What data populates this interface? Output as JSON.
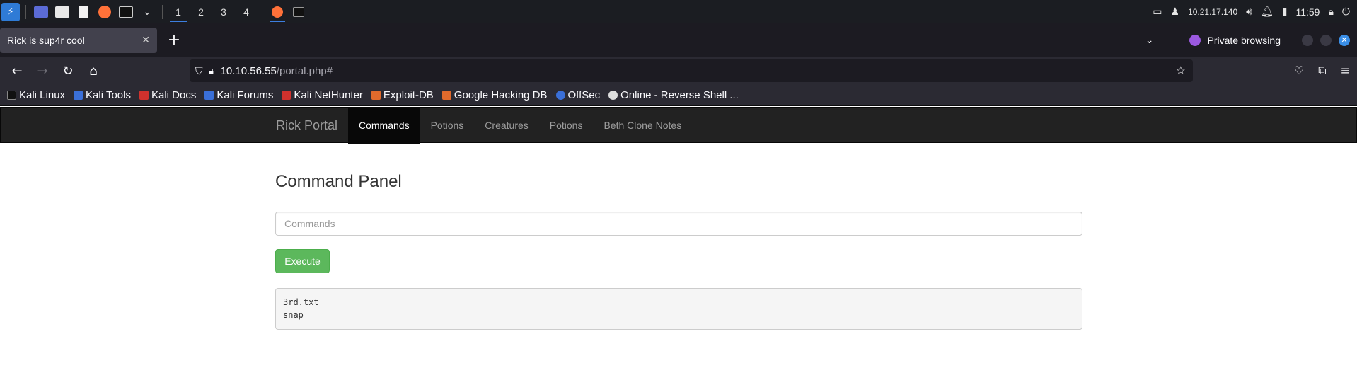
{
  "taskbar": {
    "workspaces": [
      "1",
      "2",
      "3",
      "4"
    ],
    "ip": "10.21.17.140",
    "clock": "11:59"
  },
  "browser": {
    "tab_title": "Rick is sup4r cool",
    "private_label": "Private browsing",
    "url_host": "10.10.56.55",
    "url_path": "/portal.php#"
  },
  "bookmarks": [
    {
      "label": "Kali Linux",
      "color": "#111111"
    },
    {
      "label": "Kali Tools",
      "color": "#3a6fd8"
    },
    {
      "label": "Kali Docs",
      "color": "#d0312d"
    },
    {
      "label": "Kali Forums",
      "color": "#3a6fd8"
    },
    {
      "label": "Kali NetHunter",
      "color": "#d0312d"
    },
    {
      "label": "Exploit-DB",
      "color": "#e06a2c"
    },
    {
      "label": "Google Hacking DB",
      "color": "#e06a2c"
    },
    {
      "label": "OffSec",
      "color": "#3a6fd8"
    },
    {
      "label": "Online - Reverse Shell ...",
      "color": "#dddddd"
    }
  ],
  "site": {
    "brand": "Rick Portal",
    "menu": [
      "Commands",
      "Potions",
      "Creatures",
      "Potions",
      "Beth Clone Notes"
    ],
    "panel_title": "Command Panel",
    "input_placeholder": "Commands",
    "execute_label": "Execute",
    "output_lines": [
      "3rd.txt",
      "snap"
    ]
  }
}
